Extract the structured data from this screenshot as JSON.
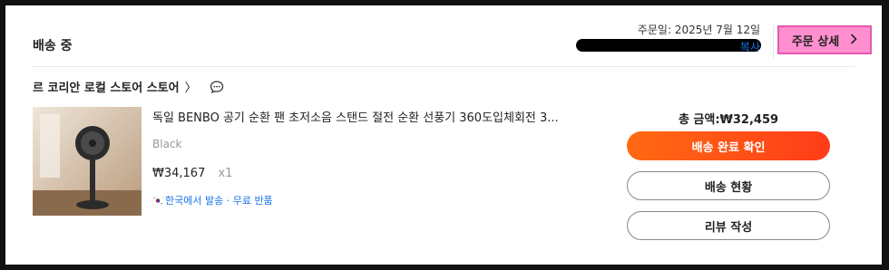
{
  "order": {
    "status": "배송 중",
    "date": "주문일: 2025년 7월 12일",
    "copy_label": "복사",
    "detail_label": "주문 상세"
  },
  "store": {
    "name": "르 코리안 로컬 스토어 스토어",
    "chevron": "〉"
  },
  "item": {
    "title": "독일 BENBO 공기 순환 팬 초저소음 스탠드 절전 순환 선풍기 360도입체회전 3...",
    "option": "Black",
    "price": "₩34,167",
    "quantity": "x1",
    "shipping_note": "한국에서 발송 · 무료 반품",
    "image_icon": "product-fan-image"
  },
  "summary": {
    "total": "총 금액:₩32,459",
    "confirm_label": "배송 완료 확인",
    "track_label": "배송 현황",
    "review_label": "리뷰 작성"
  },
  "colors": {
    "accent_start": "#ff6a13",
    "accent_end": "#ff3c19",
    "link": "#1a73e8",
    "detail_button": "#ff8fcf"
  }
}
